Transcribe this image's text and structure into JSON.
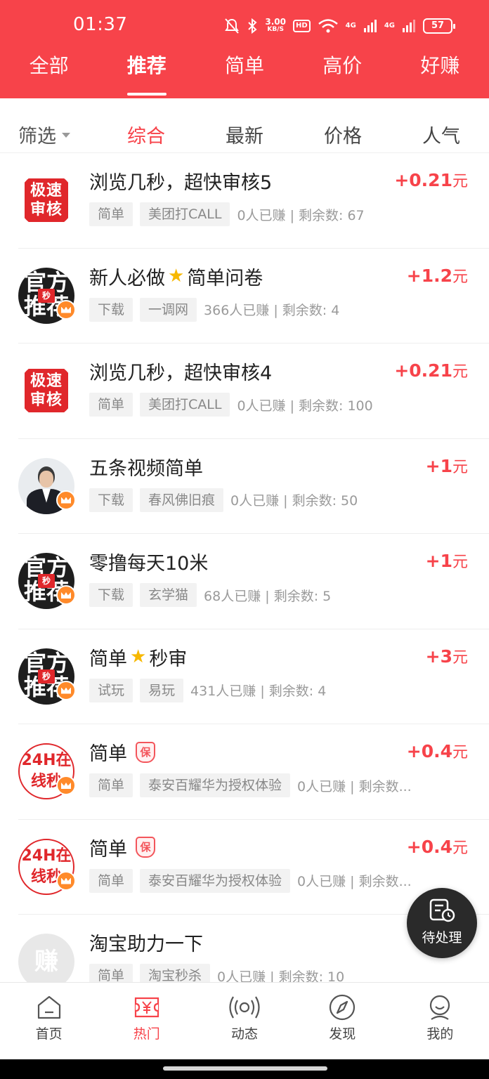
{
  "status_bar": {
    "time": "01:37",
    "speed_value": "3.00",
    "speed_unit": "KB/S",
    "hd_label": "HD",
    "net_1": "4G",
    "net_2": "4G",
    "battery": "57"
  },
  "top_tabs": [
    {
      "label": "全部",
      "active": false
    },
    {
      "label": "推荐",
      "active": true
    },
    {
      "label": "简单",
      "active": false
    },
    {
      "label": "高价",
      "active": false
    },
    {
      "label": "好赚",
      "active": false
    }
  ],
  "filter": {
    "select_label": "筛选",
    "sort_options": [
      {
        "label": "综合",
        "active": true
      },
      {
        "label": "最新",
        "active": false
      },
      {
        "label": "价格",
        "active": false
      },
      {
        "label": "人气",
        "active": false
      }
    ]
  },
  "avatar_texts": {
    "fast": "极速审核",
    "fast_line1": "极速",
    "fast_line2": "审核",
    "official_line1": "官方",
    "official_sec": "秒",
    "official_line2": "推荐",
    "stamp_line1": "24H在",
    "stamp_line2": "线秒",
    "earn": "赚"
  },
  "tasks": [
    {
      "avatar": "fast",
      "title": "浏览几秒，超快审核5",
      "price": "+0.21",
      "unit": "元",
      "tag1": "简单",
      "tag2": "美团打CALL",
      "meta": "0人已赚 | 剩余数: 67"
    },
    {
      "avatar": "official",
      "title_a": "新人必做",
      "title_b": "简单问卷",
      "price": "+1.2",
      "unit": "元",
      "tag1": "下载",
      "tag2": "一调网",
      "meta": "366人已赚 | 剩余数: 4"
    },
    {
      "avatar": "fast",
      "title": "浏览几秒，超快审核4",
      "price": "+0.21",
      "unit": "元",
      "tag1": "简单",
      "tag2": "美团打CALL",
      "meta": "0人已赚 | 剩余数: 100"
    },
    {
      "avatar": "person",
      "title": "五条视频简单",
      "price": "+1",
      "unit": "元",
      "tag1": "下载",
      "tag2": "春风佛旧痕",
      "meta": "0人已赚 | 剩余数: 50"
    },
    {
      "avatar": "official",
      "title": "零撸每天10米",
      "price": "+1",
      "unit": "元",
      "tag1": "下载",
      "tag2": "玄学猫",
      "meta": "68人已赚 | 剩余数: 5"
    },
    {
      "avatar": "official",
      "title_a": "简单",
      "title_b": "秒审",
      "price": "+3",
      "unit": "元",
      "tag1": "试玩",
      "tag2": "易玩",
      "meta": "431人已赚 | 剩余数: 4"
    },
    {
      "avatar": "stamp",
      "title": "简单",
      "badge": "保",
      "price": "+0.4",
      "unit": "元",
      "tag1": "简单",
      "tag2": "泰安百耀华为授权体验",
      "meta": "0人已赚 | 剩余数..."
    },
    {
      "avatar": "stamp",
      "title": "简单",
      "badge": "保",
      "price": "+0.4",
      "unit": "元",
      "tag1": "简单",
      "tag2": "泰安百耀华为授权体验",
      "meta": "0人已赚 | 剩余数..."
    },
    {
      "avatar": "earn",
      "title": "淘宝助力一下",
      "price": "",
      "unit": "",
      "tag1": "简单",
      "tag2": "淘宝秒杀",
      "meta": "0人已赚 | 剩余数: 10"
    }
  ],
  "float_button": {
    "label": "待处理",
    "icon": "pending-clock-icon"
  },
  "bottom_nav": [
    {
      "label": "首页",
      "icon": "home-icon",
      "active": false
    },
    {
      "label": "热门",
      "icon": "hot-yuan-icon",
      "active": true
    },
    {
      "label": "动态",
      "icon": "broadcast-icon",
      "active": false
    },
    {
      "label": "发现",
      "icon": "compass-icon",
      "active": false
    },
    {
      "label": "我的",
      "icon": "profile-icon",
      "active": false
    }
  ],
  "colors": {
    "brand_red": "#f7434a",
    "price_red": "#f7434a",
    "tag_bg": "#f2f2f2"
  }
}
